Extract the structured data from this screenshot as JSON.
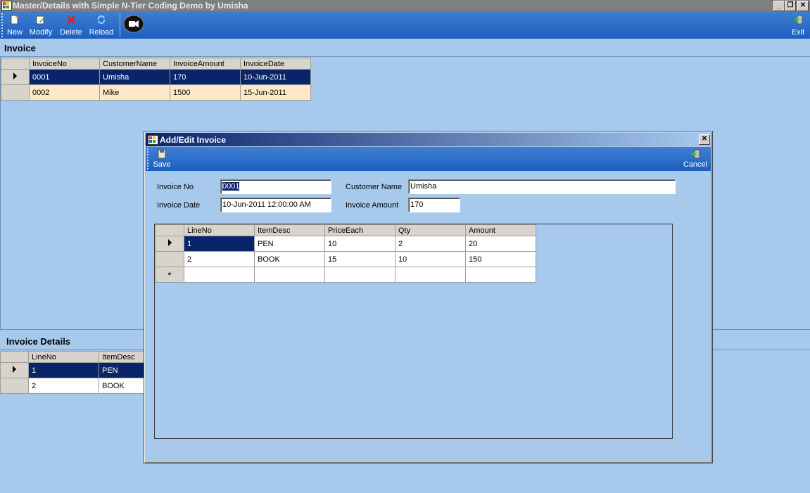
{
  "window": {
    "title": "Master/Details with Simple N-Tier Coding Demo by Umisha"
  },
  "toolbar": {
    "new_label": "New",
    "modify_label": "Modify",
    "delete_label": "Delete",
    "reload_label": "Reload",
    "exit_label": "Exit"
  },
  "invoice": {
    "section_title": "Invoice",
    "columns": [
      "InvoiceNo",
      "CustomerName",
      "InvoiceAmount",
      "InvoiceDate"
    ],
    "rows": [
      [
        "0001",
        "Umisha",
        "170",
        "10-Jun-2011"
      ],
      [
        "0002",
        "Mike",
        "1500",
        "15-Jun-2011"
      ]
    ]
  },
  "details": {
    "section_title": "Invoice Details",
    "columns": [
      "LineNo",
      "ItemDesc"
    ],
    "rows": [
      [
        "1",
        "PEN"
      ],
      [
        "2",
        "BOOK"
      ]
    ]
  },
  "dialog": {
    "title": "Add/Edit Invoice",
    "save_label": "Save",
    "cancel_label": "Cancel",
    "invoice_no_label": "Invoice No",
    "invoice_no_value": "0001",
    "customer_name_label": "Customer Name",
    "customer_name_value": "Umisha",
    "invoice_date_label": "Invoice Date",
    "invoice_date_value": "10-Jun-2011 12:00:00 AM",
    "invoice_amount_label": "Invoice Amount",
    "invoice_amount_value": "170",
    "grid": {
      "columns": [
        "LineNo",
        "ItemDesc",
        "PriceEach",
        "Qty",
        "Amount"
      ],
      "rows": [
        [
          "1",
          "PEN",
          "10",
          "2",
          "20"
        ],
        [
          "2",
          "BOOK",
          "15",
          "10",
          "150"
        ]
      ],
      "new_row_marker": "*"
    }
  },
  "colors": {
    "background": "#a6c9ec",
    "selection": "#0a246a",
    "alt_row": "#fde9c9",
    "toolbar": "#2a6dc8"
  }
}
